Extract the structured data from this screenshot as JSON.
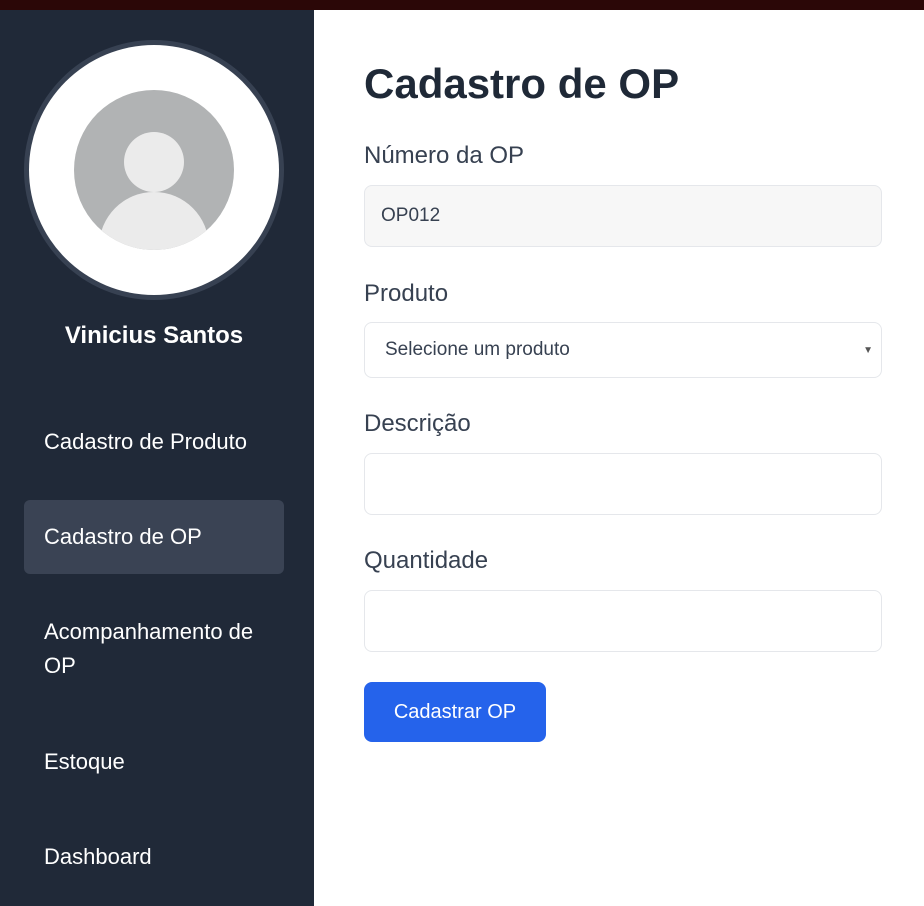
{
  "user": {
    "name": "Vinicius Santos",
    "avatar_icon": "user-placeholder-icon"
  },
  "sidebar": {
    "items": [
      {
        "label": "Cadastro de Produto",
        "active": false
      },
      {
        "label": "Cadastro de OP",
        "active": true
      },
      {
        "label": "Acompanhamento de OP",
        "active": false
      },
      {
        "label": "Estoque",
        "active": false
      },
      {
        "label": "Dashboard",
        "active": false
      }
    ]
  },
  "form": {
    "title": "Cadastro de OP",
    "numero_op": {
      "label": "Número da OP",
      "value": "OP012"
    },
    "produto": {
      "label": "Produto",
      "selected": "Selecione um produto"
    },
    "descricao": {
      "label": "Descrição",
      "value": ""
    },
    "quantidade": {
      "label": "Quantidade",
      "value": ""
    },
    "submit_label": "Cadastrar OP"
  },
  "colors": {
    "sidebar_bg": "#202938",
    "sidebar_active": "#3a4354",
    "accent": "#2563eb",
    "topbar": "#2b0707"
  }
}
